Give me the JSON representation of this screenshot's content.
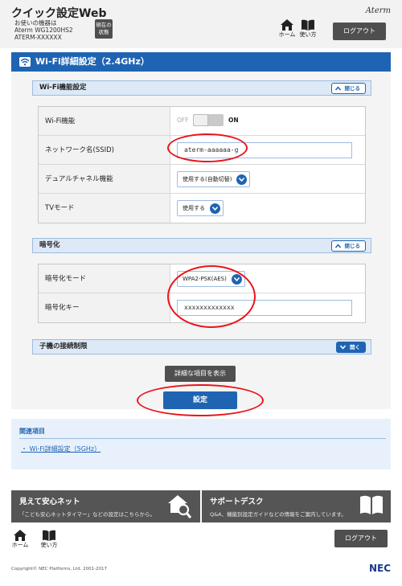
{
  "header": {
    "app_title": "クイック設定Web",
    "device_caption": "お使いの機器は",
    "device_model": "Aterm WG1200HS2",
    "device_serial": "ATERM-XXXXXX",
    "status_button": "現在の\n状態",
    "brand": "Aterm",
    "home_label": "ホーム",
    "manual_label": "使い方",
    "logout_label": "ログアウト"
  },
  "page": {
    "title": "Wi-Fi詳細設定（2.4GHz）"
  },
  "wifi_section": {
    "title": "Wi-Fi機能設定",
    "toggle_label": "閉じる",
    "rows": [
      {
        "label": "Wi-Fi機能",
        "off_text": "OFF",
        "on_text": "ON"
      },
      {
        "label": "ネットワーク名(SSID)",
        "value": "aterm-aaaaaa-g"
      },
      {
        "label": "デュアルチャネル機能",
        "value": "使用する(自動切替)"
      },
      {
        "label": "TVモード",
        "value": "使用する"
      }
    ]
  },
  "encryption_section": {
    "title": "暗号化",
    "toggle_label": "閉じる",
    "rows": [
      {
        "label": "暗号化モード",
        "value": "WPA2-PSK(AES)"
      },
      {
        "label": "暗号化キー",
        "value": "xxxxxxxxxxxxx"
      }
    ]
  },
  "child_section": {
    "title": "子機の接続制限",
    "toggle_label": "開く"
  },
  "actions": {
    "show_details": "詳細な項目を表示",
    "submit": "設定"
  },
  "related": {
    "title": "関連項目",
    "link": "Wi-Fi詳細設定（5GHz）"
  },
  "promo": [
    {
      "title": "見えて安心ネット",
      "subtitle": "「こども安心ネットタイマー」などの設定はこちらから。",
      "icon": "house-search-icon"
    },
    {
      "title": "サポートデスク",
      "subtitle": "Q&A、機能別設定ガイドなどの情報をご案内しています。",
      "icon": "book-icon"
    }
  ],
  "footer": {
    "home_label": "ホーム",
    "manual_label": "使い方",
    "logout_label": "ログアウト",
    "copyright": "Copyright© NEC Platforms, Ltd. 2001-2017",
    "maker": "NEC"
  },
  "colors": {
    "accent": "#1f64b3",
    "section_bg": "#dde9f6",
    "highlight_red": "#e8151b",
    "dark_button": "#4f4f4f"
  }
}
